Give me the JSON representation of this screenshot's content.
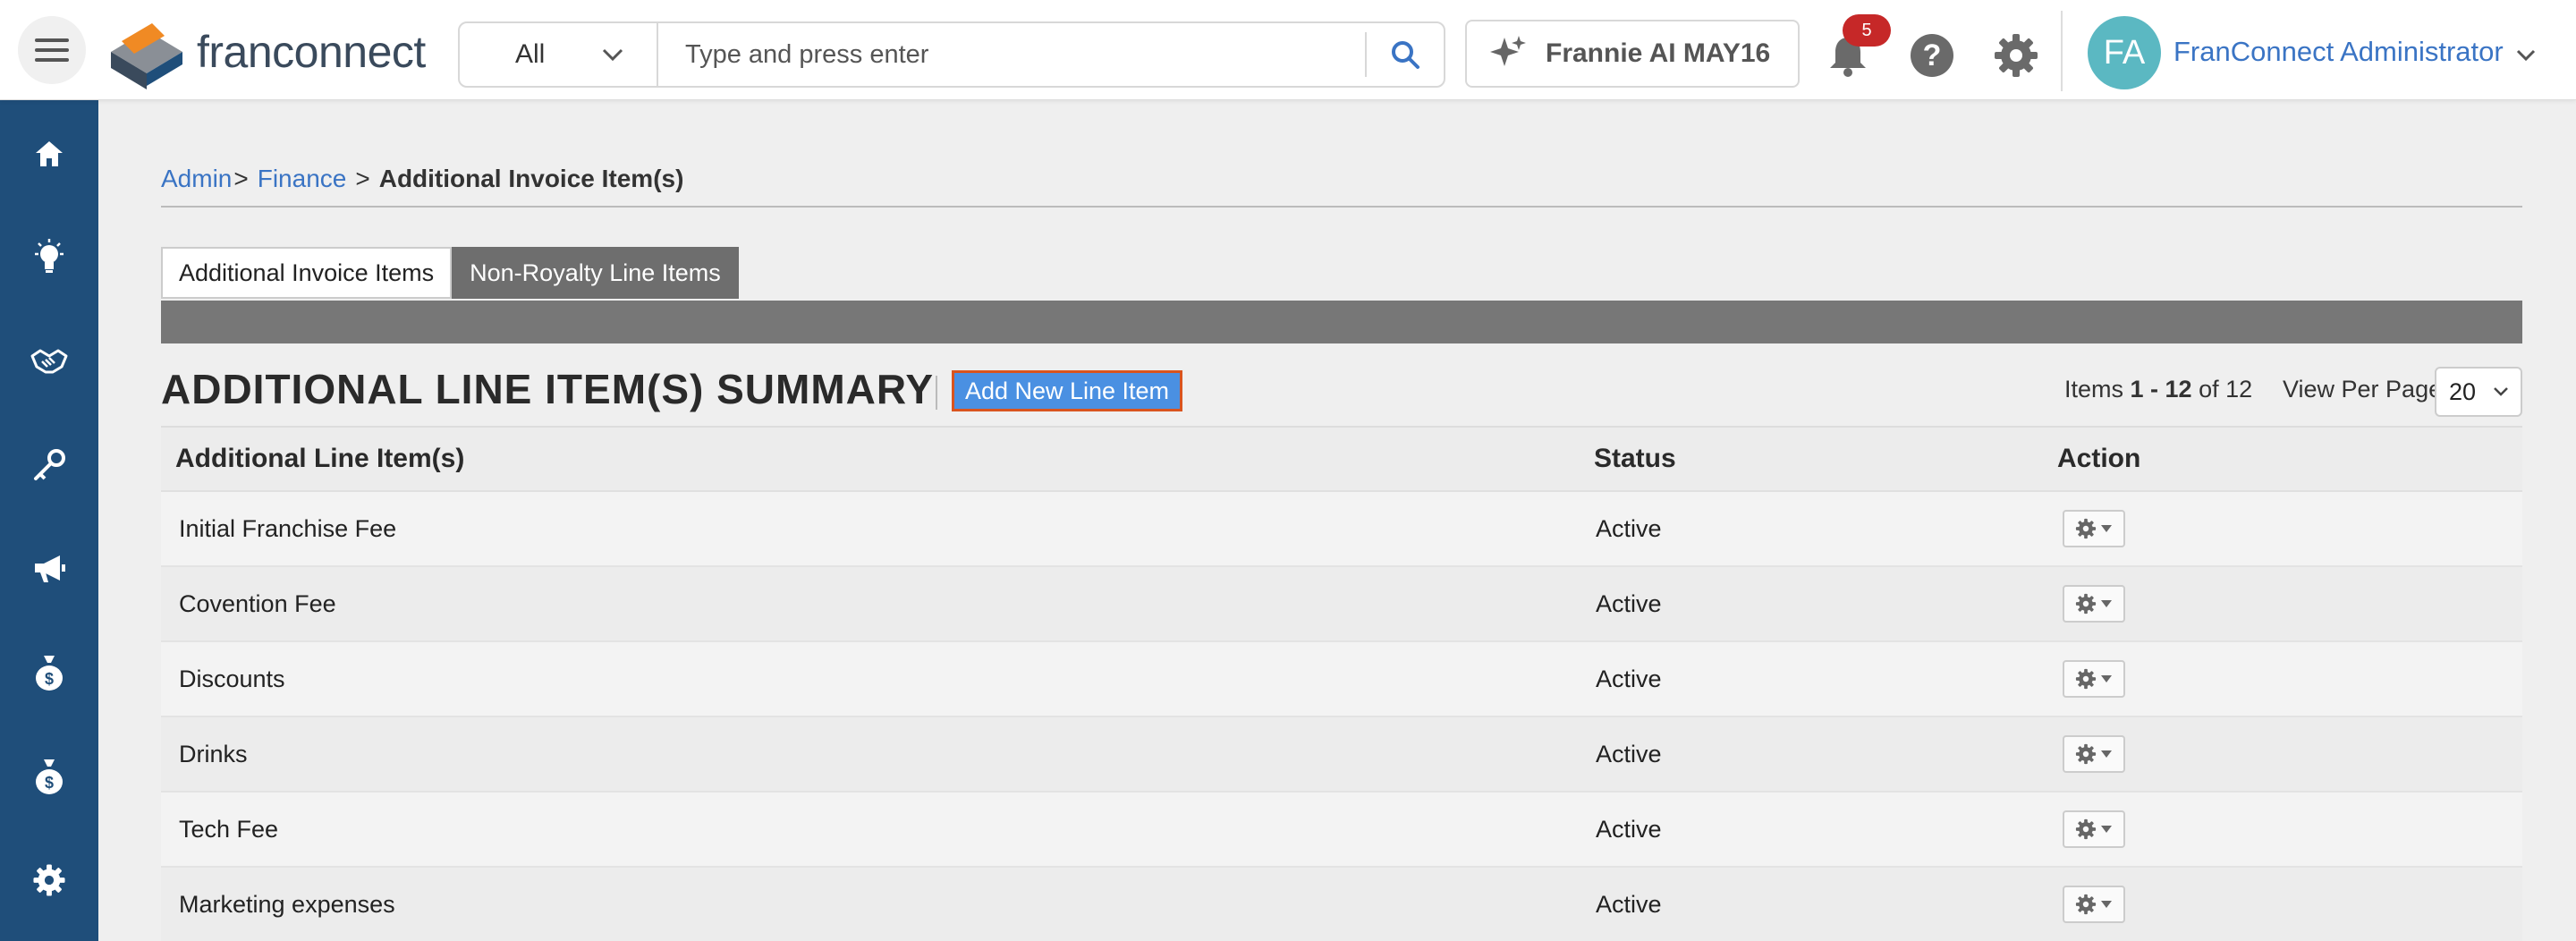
{
  "topbar": {
    "logo_text_1": "fran",
    "logo_text_2": "connect",
    "search_scope": "All",
    "search_placeholder": "Type and press enter",
    "ai_label": "Frannie AI MAY16",
    "notification_count": "5",
    "help_glyph": "?",
    "avatar_initials": "FA",
    "user_name": "FranConnect Administrator"
  },
  "sidebar": {
    "items": [
      {
        "icon": "home-icon"
      },
      {
        "icon": "lightbulb-icon"
      },
      {
        "icon": "handshake-icon"
      },
      {
        "icon": "key-icon"
      },
      {
        "icon": "megaphone-icon"
      },
      {
        "icon": "money-bag-icon"
      },
      {
        "icon": "money-bag-icon"
      },
      {
        "icon": "gear-icon"
      }
    ],
    "color": "#1f4e7a"
  },
  "breadcrumb": {
    "admin": "Admin",
    "sep1": ">",
    "finance": "Finance",
    "sep2": ">",
    "current": "Additional Invoice Item(s)"
  },
  "tabs": [
    {
      "label": "Additional Invoice Items",
      "active": false
    },
    {
      "label": "Non-Royalty Line Items",
      "active": true
    }
  ],
  "summary": {
    "title": "ADDITIONAL LINE ITEM(S) SUMMARY",
    "add_button": "Add New Line Item",
    "items_label": "Items",
    "items_range": "1 - 12",
    "items_of": "of 12",
    "view_per_page_label": "View Per Page",
    "view_per_page_value": "20"
  },
  "table": {
    "headers": {
      "name": "Additional Line Item(s)",
      "status": "Status",
      "action": "Action"
    },
    "rows": [
      {
        "name": "Initial Franchise Fee",
        "status": "Active"
      },
      {
        "name": "Covention Fee",
        "status": "Active"
      },
      {
        "name": "Discounts",
        "status": "Active"
      },
      {
        "name": "Drinks",
        "status": "Active"
      },
      {
        "name": "Tech Fee",
        "status": "Active"
      },
      {
        "name": "Marketing expenses",
        "status": "Active"
      }
    ]
  },
  "colors": {
    "accent": "#3a74c4",
    "button": "#4a90e2",
    "button_border": "#d9541e",
    "badge": "#c62828"
  }
}
